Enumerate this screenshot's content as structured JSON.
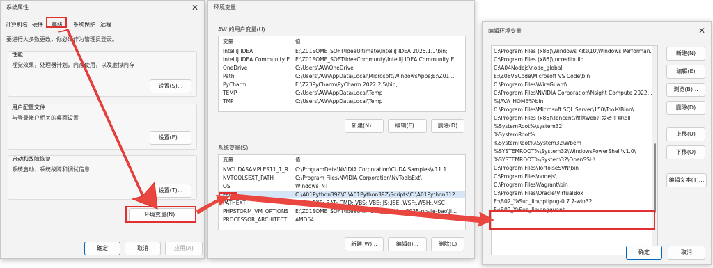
{
  "sysprops": {
    "title": "系统属性",
    "tabs": [
      "计算机名",
      "硬件",
      "高级",
      "系统保护",
      "远程"
    ],
    "notice": "要进行大多数更改，你必须作为管理员登录。",
    "performance": {
      "label": "性能",
      "desc": "视觉效果，处理器计划，内存使用，以及虚拟内存",
      "button": "设置(S)..."
    },
    "profile": {
      "label": "用户配置文件",
      "desc": "与登录帐户相关的桌面设置",
      "button": "设置(E)..."
    },
    "startup": {
      "label": "启动和故障恢复",
      "desc": "系统启动、系统故障和调试信息",
      "button": "设置(T)..."
    },
    "env_button": "环境变量(N)...",
    "ok": "确定",
    "cancel": "取消",
    "apply": "应用(A)"
  },
  "envvars": {
    "title": "环境变量",
    "user_label": "AW 的用户变量(U)",
    "col_var": "变量",
    "col_val": "值",
    "user_rows": [
      {
        "name": "IntelliJ IDEA",
        "value": "E:\\Z01SOME_SOFT\\IdeaUltimate\\IntelliJ IDEA 2025.1.1\\bin;"
      },
      {
        "name": "IntelliJ IDEA Community E...",
        "value": "E:\\Z01SOME_SOFT\\IdeaCommunty\\IntelliJ IDEA Community E..."
      },
      {
        "name": "OneDrive",
        "value": "C:\\Users\\AW\\OneDrive"
      },
      {
        "name": "Path",
        "value": "C:\\Users\\AW\\AppData\\Local\\Microsoft\\WindowsApps;E:\\Z01..."
      },
      {
        "name": "PyCharm",
        "value": "E:\\Z23PyCharm\\PyCharm 2022.2.5\\bin;"
      },
      {
        "name": "TEMP",
        "value": "C:\\Users\\AW\\AppData\\Local\\Temp"
      },
      {
        "name": "TMP",
        "value": "C:\\Users\\AW\\AppData\\Local\\Temp"
      }
    ],
    "user_new": "新建(N)...",
    "user_edit": "编辑(E)...",
    "user_delete": "删除(D)",
    "sys_label": "系统变量(S)",
    "sys_rows": [
      {
        "name": "NVCUDASAMPLES11_1_R...",
        "value": "C:\\ProgramData\\NVIDIA Corporation\\CUDA Samples\\v11.1"
      },
      {
        "name": "NVTOOLSEXT_PATH",
        "value": "C:\\Program Files\\NVIDIA Corporation\\NvToolsExt\\"
      },
      {
        "name": "OS",
        "value": "Windows_NT"
      },
      {
        "name": "Path",
        "value": "C:\\A01Python39Z\\C:\\A01Python39Z\\Scripts\\C:\\A01Python312..."
      },
      {
        "name": "PATHEXT",
        "value": ".COM;.EXE;.BAT;.CMD;.VBS;.VBE;.JS;.JSE;.WSF;.WSH;.MSC"
      },
      {
        "name": "PHPSTORM_VM_OPTIONS",
        "value": "E:\\Z01SOME_SOFT\\IdeaUltimate\\JetBrains-2025-po-jie-bao\\ji..."
      },
      {
        "name": "PROCESSOR_ARCHITECT...",
        "value": "AMD64"
      }
    ],
    "sys_new": "新建(W)...",
    "sys_edit": "编辑(I)...",
    "sys_delete": "删除(L)"
  },
  "editenv": {
    "title": "编辑环境变量",
    "items": [
      "C:\\Program Files (x86)\\Windows Kits\\10\\Windows Performan...",
      "C:\\Program Files (x86)\\Incredibuild",
      "C:\\A04Nodejs\\node_global",
      "E:\\Z08VSCode\\Microsoft VS Code\\bin",
      "C:\\Program Files\\WireGuard\\",
      "C:\\Program Files\\NVIDIA Corporation\\Nsight Compute 2022....",
      "%JAVA_HOME%\\bin",
      "C:\\Program Files\\Microsoft SQL Server\\150\\Tools\\Binn\\",
      "C:\\Program Files (x86)\\Tencent\\微信web开发者工具\\dll",
      "%SystemRoot%\\system32",
      "%SystemRoot%",
      "%SystemRoot%\\System32\\Wbem",
      "%SYSTEMROOT%\\System32\\WindowsPowerShell\\v1.0\\",
      "%SYSTEMROOT%\\System32\\OpenSSH\\",
      "C:\\Program Files\\TortoiseSVN\\bin",
      "C:\\Program Files\\nodejs\\",
      "C:\\Program Files\\Vagrant\\bin",
      "C:\\Program Files\\Oracle\\VirtualBox",
      "E:\\B02_YaSuo_lib\\optipng-0.7.7-win32",
      "E:\\B02_YaSuo_lib\\pngquant"
    ],
    "new": "新建(N)",
    "edit": "编辑(E)",
    "browse": "浏览(B)...",
    "delete": "删除(D)",
    "up": "上移(U)",
    "down": "下移(O)",
    "edit_text": "编辑文本(T)...",
    "ok": "确定",
    "cancel": "取消"
  },
  "annotation_color": "#e03030"
}
